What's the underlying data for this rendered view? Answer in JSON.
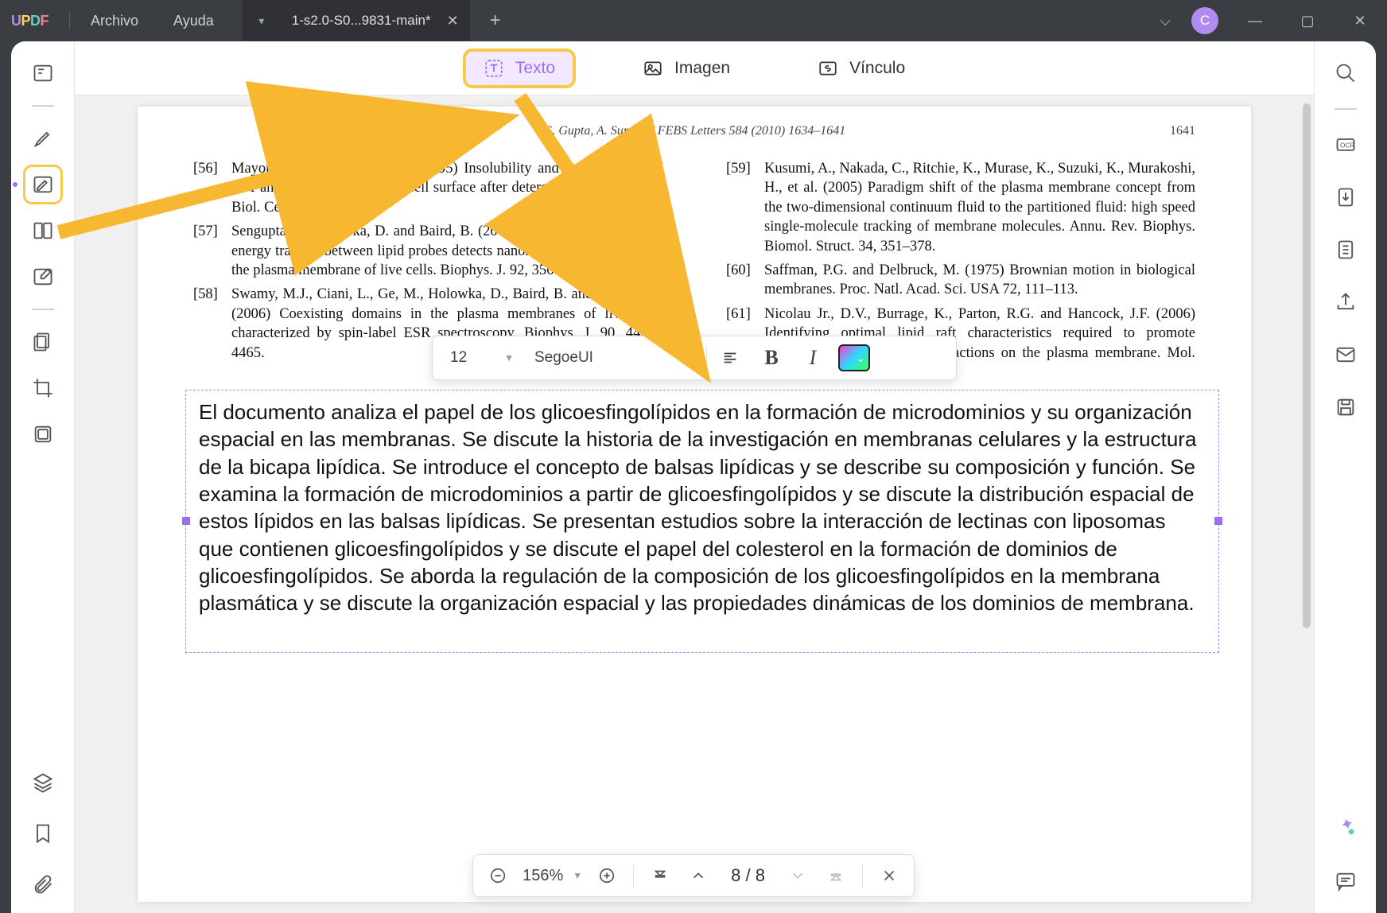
{
  "titlebar": {
    "logo_letters": [
      "U",
      "P",
      "D",
      "F"
    ],
    "menu": {
      "file": "Archivo",
      "help": "Ayuda"
    },
    "tab_title": "1-s2.0-S0...9831-main*",
    "avatar_initial": "C"
  },
  "edit_toolbar": {
    "text": "Texto",
    "image": "Imagen",
    "link": "Vínculo"
  },
  "document": {
    "running_head": "G. Gupta, A. Surolia / FEBS Letters 584 (2010) 1634–1641",
    "page_number_label": "1641",
    "refs_left": [
      {
        "num": "[56]",
        "txt": "Mayor, S. and Maxfield, F.R. (1995) Insolubility and redistribution of GPI-anchored proteins at the cell surface after detergent treatment. Mol. Biol. Cell 6, 929–944."
      },
      {
        "num": "[57]",
        "txt": "Sengupta, P., Holowka, D. and Baird, B. (2007) Fluorescence resonance energy transfer between lipid probes detects nanoscopic heterogeneity in the plasma membrane of live cells. Biophys. J. 92, 3564–3574."
      },
      {
        "num": "[58]",
        "txt": "Swamy, M.J., Ciani, L., Ge, M., Holowka, D., Baird, B. and Freed, J.H. (2006) Coexisting domains in the plasma membranes of live cells characterized by spin-label ESR spectroscopy. Biophys. J. 90, 4452–4465."
      }
    ],
    "refs_right": [
      {
        "num": "[59]",
        "txt": "Kusumi, A., Nakada, C., Ritchie, K., Murase, K., Suzuki, K., Murakoshi, H., et al. (2005) Paradigm shift of the plasma membrane concept from the two-dimensional continuum fluid to the partitioned fluid: high speed single-molecule tracking of membrane molecules. Annu. Rev. Biophys. Biomol. Struct. 34, 351–378."
      },
      {
        "num": "[60]",
        "txt": "Saffman, P.G. and Delbruck, M. (1975) Brownian motion in biological membranes. Proc. Natl. Acad. Sci. USA 72, 111–113."
      },
      {
        "num": "[61]",
        "txt": "Nicolau Jr., D.V., Burrage, K., Parton, R.G. and Hancock, J.F. (2006) Identifying optimal lipid raft characteristics required to promote nanoscale protein–protein interactions on the plasma membrane. Mol. Cell. Biol. 26, 313–323."
      }
    ],
    "editable_text": "El documento analiza el papel de los glicoesfingolípidos en la formación de microdominios y su organización espacial en las membranas. Se discute la historia de la investigación en membranas celulares y la estructura de la bicapa lipídica. Se introduce el concepto de balsas lipídicas y se describe su composición y función. Se examina la formación de microdominios a partir de glicoesfingolípidos y se discute la distribución espacial de estos lípidos en las balsas lipídicas. Se presentan estudios sobre la interacción de lectinas con liposomas que contienen glicoesfingolípidos y se discute el papel del colesterol en la formación de dominios de glicoesfingolípidos. Se aborda la regulación de la composición de los glicoesfingolípidos en la membrana plasmática y se discute la organización espacial y las propiedades dinámicas de los dominios de membrana."
  },
  "format_bar": {
    "font_size": "12",
    "font_family": "SegoeUI",
    "bold_label": "B",
    "italic_label": "I"
  },
  "zoom_bar": {
    "zoom_value": "156%",
    "page_display": "8  /  8"
  }
}
